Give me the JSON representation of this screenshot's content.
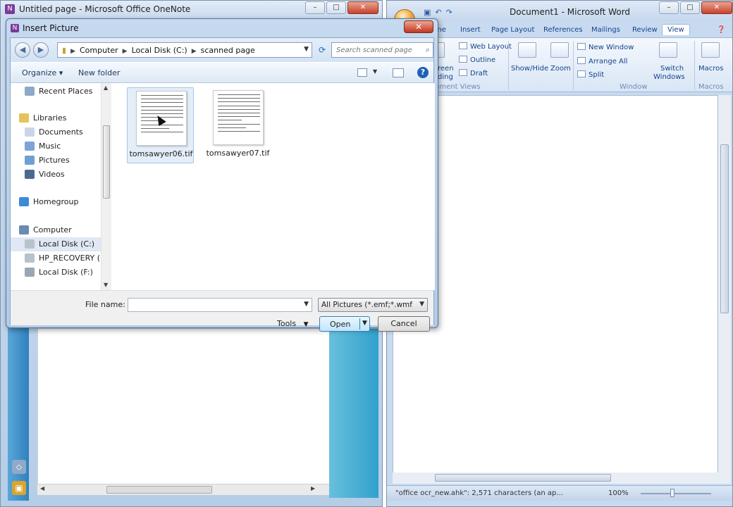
{
  "onenote": {
    "title": "Untitled page - Microsoft Office OneNote",
    "icon_letter": "N",
    "controls": [
      "–",
      "□",
      "✕"
    ]
  },
  "word": {
    "title": "Document1 - Microsoft Word",
    "tabs": [
      "me",
      "Insert",
      "Page Layout",
      "References",
      "Mailings",
      "Review",
      "View"
    ],
    "active_tab": "View",
    "ribbon": {
      "full_screen_label": "reen\nding",
      "web_layout": "Web Layout",
      "outline": "Outline",
      "draft": "Draft",
      "doc_views_group": "ument Views",
      "show_hide": "Show/Hide",
      "zoom": "Zoom",
      "new_window": "New Window",
      "arrange_all": "Arrange All",
      "split": "Split",
      "window_group": "Window",
      "switch_windows_1": "Switch",
      "switch_windows_2": "Windows",
      "macros": "Macros",
      "macros_group": "Macros"
    },
    "status_text": "\"office ocr_new.ahk\": 2,571 characters (an ap...",
    "zoom_level": "100%",
    "controls": [
      "–",
      "□",
      "✕"
    ]
  },
  "dialog": {
    "title": "Insert Picture",
    "icon_letter": "N",
    "close_glyph": "✕",
    "breadcrumb": [
      "Computer",
      "Local Disk (C:)",
      "scanned page"
    ],
    "search_placeholder": "Search scanned page",
    "commands": {
      "organize": "Organize ▾",
      "new_folder": "New folder",
      "help": "?"
    },
    "nav": [
      {
        "label": "Recent Places",
        "icon": "recent-places-icon",
        "color": "#8ea8c9"
      },
      {
        "label": "Libraries",
        "icon": "libraries-icon",
        "color": "#e5c25a"
      },
      {
        "label": "Documents",
        "icon": "documents-icon",
        "color": "#c9d6e8"
      },
      {
        "label": "Music",
        "icon": "music-icon",
        "color": "#7ba4d8"
      },
      {
        "label": "Pictures",
        "icon": "pictures-icon",
        "color": "#6fa0d2"
      },
      {
        "label": "Videos",
        "icon": "videos-icon",
        "color": "#4b6a8f"
      },
      {
        "label": "Homegroup",
        "icon": "homegroup-icon",
        "color": "#3d8ad6"
      },
      {
        "label": "Computer",
        "icon": "computer-icon",
        "color": "#6c8bb0"
      },
      {
        "label": "Local Disk (C:)",
        "icon": "drive-icon",
        "color": "#b8c2cd"
      },
      {
        "label": "HP_RECOVERY (D",
        "icon": "drive-icon",
        "color": "#b8c2cd"
      },
      {
        "label": "Local Disk (F:)",
        "icon": "drive-icon",
        "color": "#9aa6b3"
      }
    ],
    "selected_nav": "Local Disk (C:)",
    "files": [
      {
        "name": "tomsawyer06.tif",
        "selected": true
      },
      {
        "name": "tomsawyer07.tif",
        "selected": false
      }
    ],
    "file_name_label": "File name:",
    "file_name_value": "",
    "filter": "All Pictures (*.emf;*.wmf;*.jp",
    "tools": "Tools",
    "open": "Open",
    "cancel": "Cancel"
  }
}
